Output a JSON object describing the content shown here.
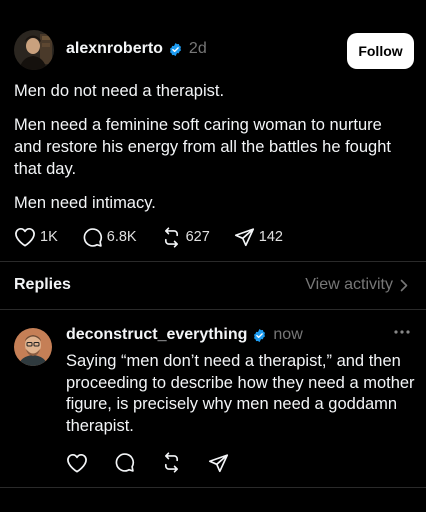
{
  "post": {
    "username": "alexnroberto",
    "timestamp": "2d",
    "follow_label": "Follow",
    "paragraphs": [
      "Men do not need a therapist.",
      "Men need a feminine soft caring woman to nurture and restore his energy from all the battles he fought that day.",
      "Men need intimacy."
    ],
    "stats": {
      "likes": "1K",
      "comments": "6.8K",
      "reposts": "627",
      "shares": "142"
    }
  },
  "replies_section": {
    "title": "Replies",
    "view_activity": "View activity"
  },
  "reply": {
    "username": "deconstruct_everything",
    "timestamp": "now",
    "text": "Saying “men don’t need a therapist,” and then proceeding to describe how they need a mother figure, is precisely why men need a goddamn therapist."
  },
  "colors": {
    "background": "#000000",
    "text_primary": "#f3f5f7",
    "text_secondary": "#777777",
    "verified": "#1d9bf0"
  }
}
